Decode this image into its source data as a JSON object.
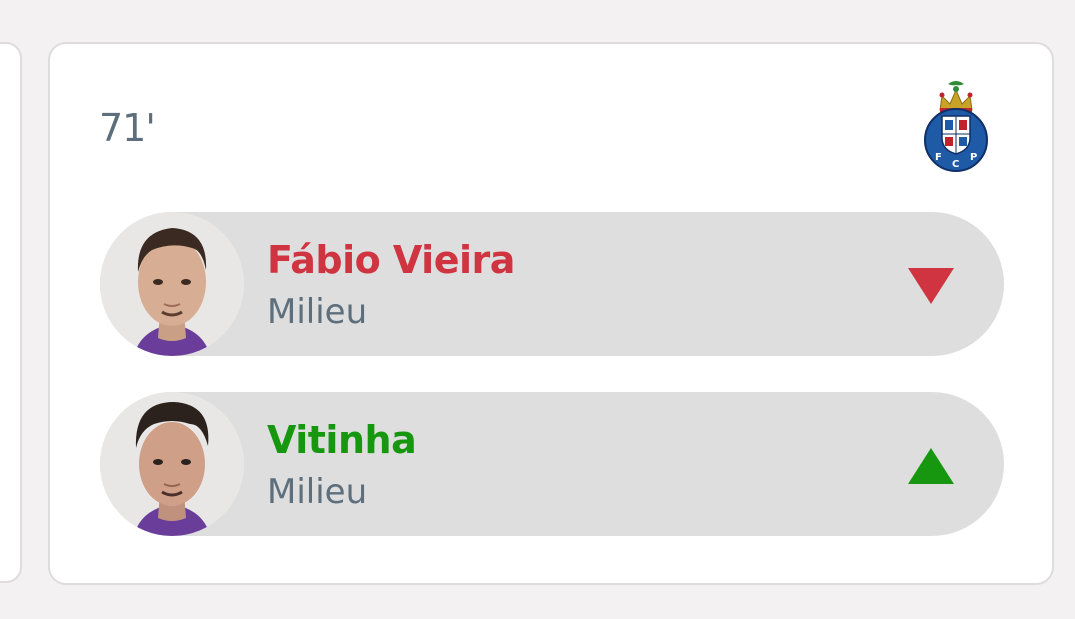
{
  "event": {
    "minute": "71'",
    "team_crest_icon": "fc-porto-crest-icon",
    "player_out": {
      "name": "Fábio Vieira",
      "position": "Milieu",
      "indicator_icon": "triangle-down-icon",
      "color": "#cf3440"
    },
    "player_in": {
      "name": "Vitinha",
      "position": "Milieu",
      "indicator_icon": "triangle-up-icon",
      "color": "#16970f"
    }
  }
}
